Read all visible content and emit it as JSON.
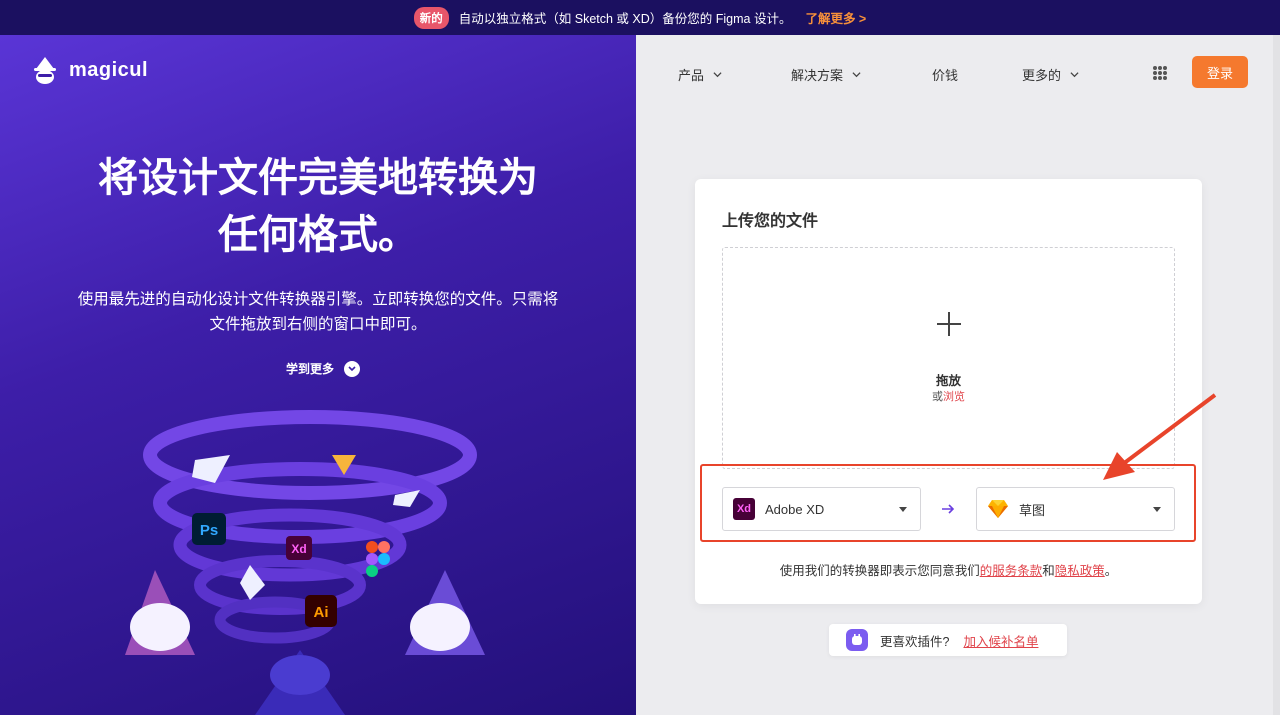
{
  "banner": {
    "badge": "新的",
    "text": "自动以独立格式（如 Sketch 或 XD）备份您的 Figma 设计。",
    "link": "了解更多 >"
  },
  "brand": {
    "name": "magicul"
  },
  "hero": {
    "title_line1": "将设计文件完美地转换为",
    "title_line2": "任何格式。",
    "subtitle_line1": "使用最先进的自动化设计文件转换器引擎。立即转换您的文件。只需将",
    "subtitle_line2": "文件拖放到右侧的窗口中即可。",
    "learn_more": "学到更多",
    "illustration_labels": {
      "ps": "Ps",
      "xd": "Xd",
      "ai": "Ai"
    }
  },
  "nav": {
    "items": [
      {
        "label": "产品"
      },
      {
        "label": "解决方案"
      },
      {
        "label": "价钱"
      },
      {
        "label": "更多的"
      }
    ],
    "login": "登录"
  },
  "upload": {
    "title": "上传您的文件",
    "drop_label": "拖放",
    "or": "或",
    "browse": "浏览",
    "from_format": "Adobe XD",
    "from_icon_text": "Xd",
    "to_format": "草图",
    "terms_prefix": "使用我们的转换器即表示您同意我们",
    "terms_link": "的服务条款",
    "terms_and": "和",
    "privacy_link": "隐私政策",
    "terms_suffix": "。"
  },
  "plugin": {
    "question": "更喜欢插件?",
    "join": "加入候补名单"
  },
  "colors": {
    "accent": "#f5792e",
    "link_red": "#e0434a",
    "hero_purple": "#3d1ea8",
    "banner_bg": "#1b1060"
  }
}
